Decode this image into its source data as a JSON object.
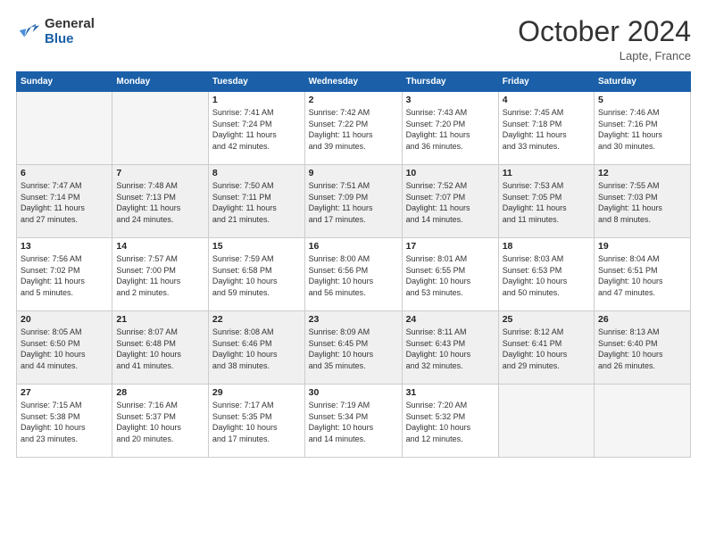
{
  "logo": {
    "line1": "General",
    "line2": "Blue"
  },
  "title": "October 2024",
  "location": "Lapte, France",
  "headers": [
    "Sunday",
    "Monday",
    "Tuesday",
    "Wednesday",
    "Thursday",
    "Friday",
    "Saturday"
  ],
  "rows": [
    [
      {
        "day": "",
        "detail": ""
      },
      {
        "day": "",
        "detail": ""
      },
      {
        "day": "1",
        "detail": "Sunrise: 7:41 AM\nSunset: 7:24 PM\nDaylight: 11 hours\nand 42 minutes."
      },
      {
        "day": "2",
        "detail": "Sunrise: 7:42 AM\nSunset: 7:22 PM\nDaylight: 11 hours\nand 39 minutes."
      },
      {
        "day": "3",
        "detail": "Sunrise: 7:43 AM\nSunset: 7:20 PM\nDaylight: 11 hours\nand 36 minutes."
      },
      {
        "day": "4",
        "detail": "Sunrise: 7:45 AM\nSunset: 7:18 PM\nDaylight: 11 hours\nand 33 minutes."
      },
      {
        "day": "5",
        "detail": "Sunrise: 7:46 AM\nSunset: 7:16 PM\nDaylight: 11 hours\nand 30 minutes."
      }
    ],
    [
      {
        "day": "6",
        "detail": "Sunrise: 7:47 AM\nSunset: 7:14 PM\nDaylight: 11 hours\nand 27 minutes."
      },
      {
        "day": "7",
        "detail": "Sunrise: 7:48 AM\nSunset: 7:13 PM\nDaylight: 11 hours\nand 24 minutes."
      },
      {
        "day": "8",
        "detail": "Sunrise: 7:50 AM\nSunset: 7:11 PM\nDaylight: 11 hours\nand 21 minutes."
      },
      {
        "day": "9",
        "detail": "Sunrise: 7:51 AM\nSunset: 7:09 PM\nDaylight: 11 hours\nand 17 minutes."
      },
      {
        "day": "10",
        "detail": "Sunrise: 7:52 AM\nSunset: 7:07 PM\nDaylight: 11 hours\nand 14 minutes."
      },
      {
        "day": "11",
        "detail": "Sunrise: 7:53 AM\nSunset: 7:05 PM\nDaylight: 11 hours\nand 11 minutes."
      },
      {
        "day": "12",
        "detail": "Sunrise: 7:55 AM\nSunset: 7:03 PM\nDaylight: 11 hours\nand 8 minutes."
      }
    ],
    [
      {
        "day": "13",
        "detail": "Sunrise: 7:56 AM\nSunset: 7:02 PM\nDaylight: 11 hours\nand 5 minutes."
      },
      {
        "day": "14",
        "detail": "Sunrise: 7:57 AM\nSunset: 7:00 PM\nDaylight: 11 hours\nand 2 minutes."
      },
      {
        "day": "15",
        "detail": "Sunrise: 7:59 AM\nSunset: 6:58 PM\nDaylight: 10 hours\nand 59 minutes."
      },
      {
        "day": "16",
        "detail": "Sunrise: 8:00 AM\nSunset: 6:56 PM\nDaylight: 10 hours\nand 56 minutes."
      },
      {
        "day": "17",
        "detail": "Sunrise: 8:01 AM\nSunset: 6:55 PM\nDaylight: 10 hours\nand 53 minutes."
      },
      {
        "day": "18",
        "detail": "Sunrise: 8:03 AM\nSunset: 6:53 PM\nDaylight: 10 hours\nand 50 minutes."
      },
      {
        "day": "19",
        "detail": "Sunrise: 8:04 AM\nSunset: 6:51 PM\nDaylight: 10 hours\nand 47 minutes."
      }
    ],
    [
      {
        "day": "20",
        "detail": "Sunrise: 8:05 AM\nSunset: 6:50 PM\nDaylight: 10 hours\nand 44 minutes."
      },
      {
        "day": "21",
        "detail": "Sunrise: 8:07 AM\nSunset: 6:48 PM\nDaylight: 10 hours\nand 41 minutes."
      },
      {
        "day": "22",
        "detail": "Sunrise: 8:08 AM\nSunset: 6:46 PM\nDaylight: 10 hours\nand 38 minutes."
      },
      {
        "day": "23",
        "detail": "Sunrise: 8:09 AM\nSunset: 6:45 PM\nDaylight: 10 hours\nand 35 minutes."
      },
      {
        "day": "24",
        "detail": "Sunrise: 8:11 AM\nSunset: 6:43 PM\nDaylight: 10 hours\nand 32 minutes."
      },
      {
        "day": "25",
        "detail": "Sunrise: 8:12 AM\nSunset: 6:41 PM\nDaylight: 10 hours\nand 29 minutes."
      },
      {
        "day": "26",
        "detail": "Sunrise: 8:13 AM\nSunset: 6:40 PM\nDaylight: 10 hours\nand 26 minutes."
      }
    ],
    [
      {
        "day": "27",
        "detail": "Sunrise: 7:15 AM\nSunset: 5:38 PM\nDaylight: 10 hours\nand 23 minutes."
      },
      {
        "day": "28",
        "detail": "Sunrise: 7:16 AM\nSunset: 5:37 PM\nDaylight: 10 hours\nand 20 minutes."
      },
      {
        "day": "29",
        "detail": "Sunrise: 7:17 AM\nSunset: 5:35 PM\nDaylight: 10 hours\nand 17 minutes."
      },
      {
        "day": "30",
        "detail": "Sunrise: 7:19 AM\nSunset: 5:34 PM\nDaylight: 10 hours\nand 14 minutes."
      },
      {
        "day": "31",
        "detail": "Sunrise: 7:20 AM\nSunset: 5:32 PM\nDaylight: 10 hours\nand 12 minutes."
      },
      {
        "day": "",
        "detail": ""
      },
      {
        "day": "",
        "detail": ""
      }
    ]
  ]
}
